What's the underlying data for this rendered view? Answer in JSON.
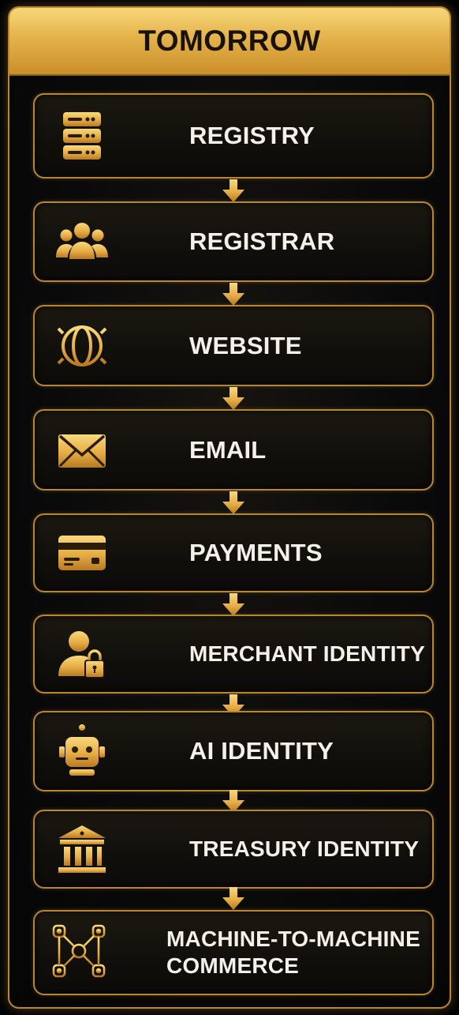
{
  "header": {
    "title": "TOMORROW"
  },
  "steps": [
    {
      "label": "REGISTRY",
      "icon": "server-icon"
    },
    {
      "label": "REGISTRAR",
      "icon": "people-icon"
    },
    {
      "label": "WEBSITE",
      "icon": "globe-icon"
    },
    {
      "label": "EMAIL",
      "icon": "envelope-icon"
    },
    {
      "label": "PAYMENTS",
      "icon": "credit-card-icon"
    },
    {
      "label": "MERCHANT IDENTITY",
      "icon": "user-lock-icon"
    },
    {
      "label": "AI IDENTITY",
      "icon": "robot-icon"
    },
    {
      "label": "TREASURY IDENTITY",
      "icon": "bank-icon"
    },
    {
      "label_line1": "MACHINE-TO-MACHINE",
      "label_line2": "COMMERCE",
      "icon": "network-icon"
    }
  ],
  "colors": {
    "gold": "#e8b24a",
    "gold_dark": "#b8862c",
    "text": "#f3f1ea",
    "background": "#0a0a0b"
  }
}
